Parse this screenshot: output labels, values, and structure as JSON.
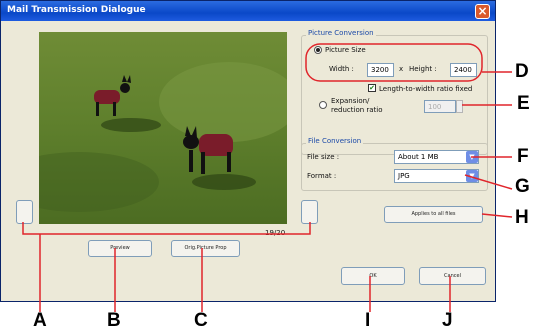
{
  "window": {
    "title": "Mail Transmission Dialogue"
  },
  "navigation": {
    "counter": "19/20"
  },
  "buttons": {
    "preview": "Preview",
    "orig_picture_prop": "Orig.Picture Prop",
    "applies_to_all_files": "Applies to all files",
    "ok": "OK",
    "cancel": "Cancel"
  },
  "picture_conversion": {
    "title": "Picture Conversion",
    "picture_size_label": "Picture Size",
    "width_label": "Width :",
    "width_value": "3200",
    "x_label": "x",
    "height_label": "Height :",
    "height_value": "2400",
    "aspect_fixed_label": "Length-to-width ratio fixed",
    "expansion_label_line1": "Expansion/",
    "expansion_label_line2": "reduction ratio",
    "ratio_value": "100"
  },
  "file_conversion": {
    "title": "File Conversion",
    "file_size_label": "File size :",
    "file_size_value": "About 1 MB",
    "format_label": "Format :",
    "format_value": "JPG"
  },
  "callouts": [
    "A",
    "B",
    "C",
    "D",
    "E",
    "F",
    "G",
    "H",
    "I",
    "J"
  ],
  "colors": {
    "callout_line": "#e0252b",
    "title_bar": "#0a48c8"
  }
}
